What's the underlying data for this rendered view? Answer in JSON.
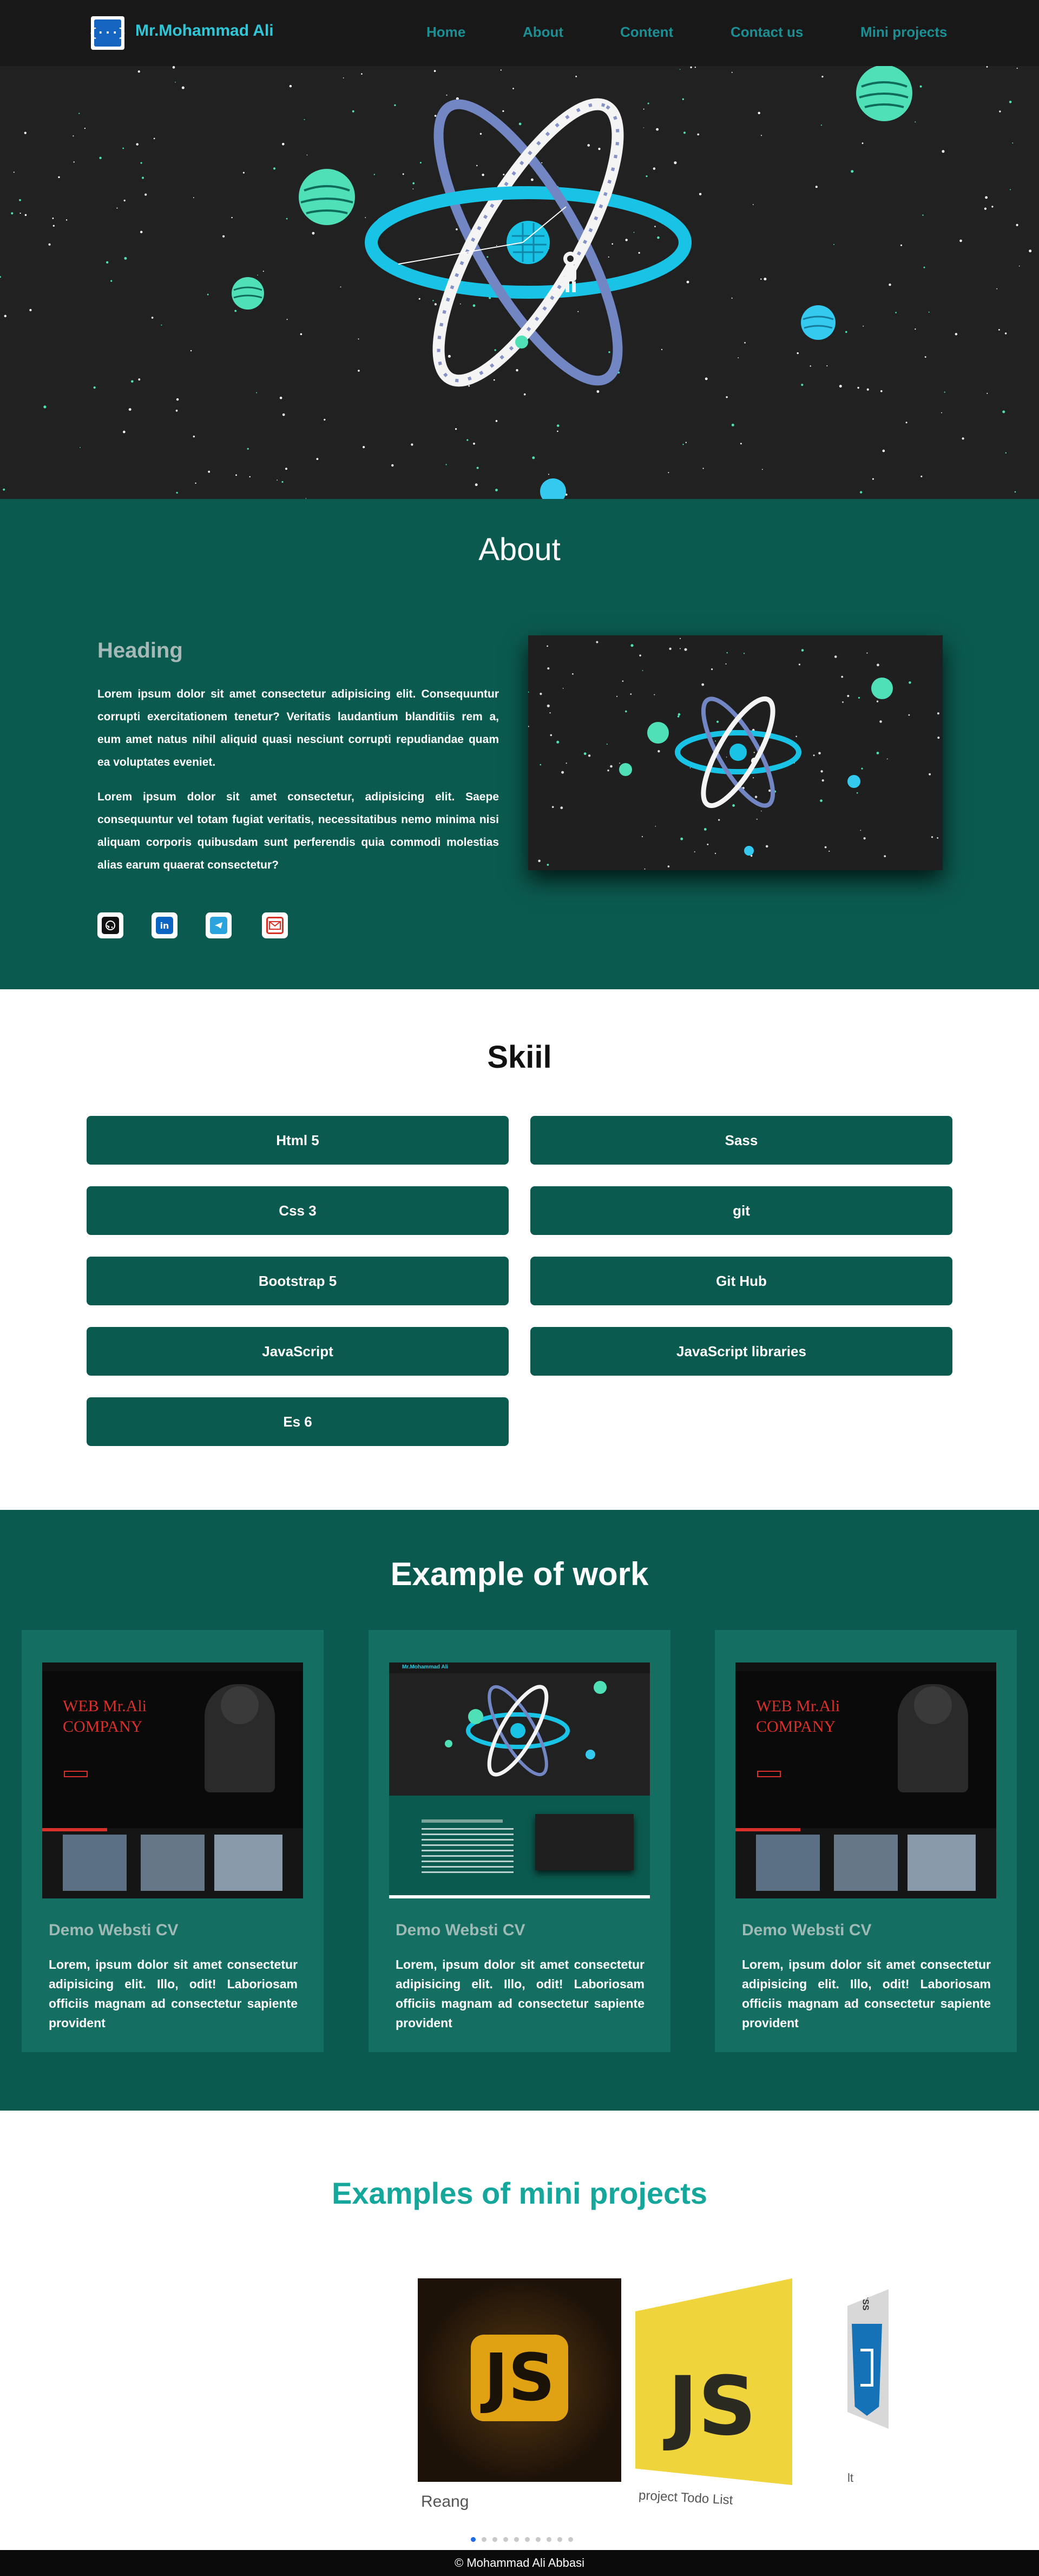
{
  "nav": {
    "logo_glyph": "{···}",
    "brand": "Mr.Mohammad Ali",
    "links": [
      "Home",
      "About",
      "Content",
      "Contact us",
      "Mini projects"
    ]
  },
  "hero": {
    "illustration": "atom-astronaut-space-illustration"
  },
  "about": {
    "title": "About",
    "heading": "Heading",
    "paragraph1": "Lorem ipsum dolor sit amet consectetur adipisicing elit. Consequuntur corrupti exercitationem tenetur? Veritatis laudantium blanditiis rem a, eum amet natus nihil aliquid quasi nesciunt corrupti repudiandae quam ea voluptates eveniet.",
    "paragraph2": "Lorem ipsum dolor sit amet consectetur, adipisicing elit. Saepe consequuntur vel totam fugiat veritatis, necessitatibus nemo minima nisi aliquam corporis quibusdam sunt perferendis quia commodi molestias alias earum quaerat consectetur?",
    "social_icons": [
      "github-icon",
      "linkedin-icon",
      "telegram-icon",
      "email-icon"
    ]
  },
  "skill": {
    "title": "Skiil",
    "items": [
      "Html 5",
      "Sass",
      "Css 3",
      "git",
      "Bootstrap 5",
      "Git Hub",
      "JavaScript",
      "JavaScript libraries",
      "Es 6"
    ]
  },
  "work": {
    "title": "Example of work",
    "cards": [
      {
        "title": "Demo Websti CV",
        "text": "Lorem, ipsum dolor sit amet consectetur adipisicing elit. Illo, odit! Laboriosam officiis magnam ad consectetur sapiente provident",
        "thumb_heading": "WEB Mr.Ali COMPANY"
      },
      {
        "title": "Demo Websti CV",
        "text": "Lorem, ipsum dolor sit amet consectetur adipisicing elit. Illo, odit! Laboriosam officiis magnam ad consectetur sapiente provident",
        "thumb_heading": "Mr.Mohammad Ali"
      },
      {
        "title": "Demo Websti CV",
        "text": "Lorem, ipsum dolor sit amet consectetur adipisicing elit. Illo, odit! Laboriosam officiis magnam ad consectetur sapiente provident",
        "thumb_heading": "WEB Mr.Ali COMPANY"
      }
    ]
  },
  "mini": {
    "title": "Examples of mini projects",
    "slides": [
      {
        "label": "Reang",
        "badge": "JS"
      },
      {
        "label": "project Todo List",
        "badge": "JS"
      },
      {
        "label": "lt",
        "badge": "CSS"
      }
    ],
    "dots_count": 10,
    "active_dot": 0
  },
  "footer": {
    "text": "© Mohammad Ali Abbasi"
  },
  "colors": {
    "nav_bg": "#181818",
    "brand": "#2fc6d8",
    "nav_link": "#1b8f93",
    "teal_section": "#0b5a4f",
    "card_bg": "#146e62",
    "accent_cyan": "#19c3e6",
    "planet_green": "#4fe0b8",
    "mini_title": "#15a69c"
  }
}
